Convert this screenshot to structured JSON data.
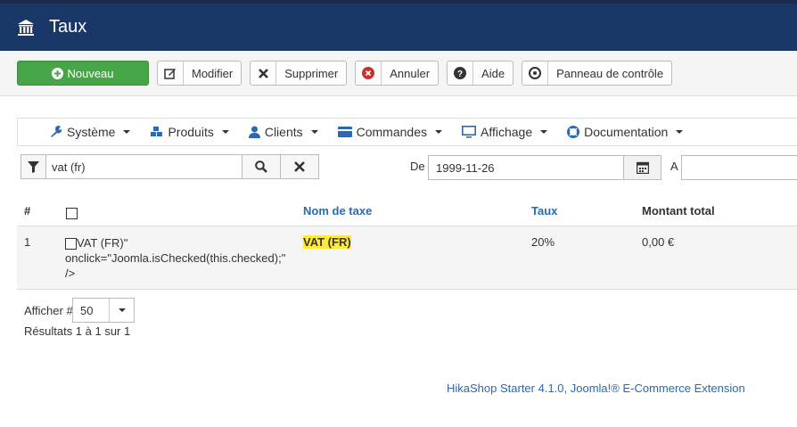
{
  "header": {
    "title": "Taux",
    "logo_icon": "bank-icon"
  },
  "toolbar": {
    "new_label": "Nouveau",
    "edit_label": "Modifier",
    "delete_label": "Supprimer",
    "cancel_label": "Annuler",
    "help_label": "Aide",
    "control_panel_label": "Panneau de contrôle"
  },
  "menu": {
    "items": [
      {
        "label": "Système",
        "icon": "wrench-icon"
      },
      {
        "label": "Produits",
        "icon": "cubes-icon"
      },
      {
        "label": "Clients",
        "icon": "user-icon"
      },
      {
        "label": "Commandes",
        "icon": "card-icon"
      },
      {
        "label": "Affichage",
        "icon": "monitor-icon"
      },
      {
        "label": "Documentation",
        "icon": "lifebuoy-icon"
      }
    ]
  },
  "filter": {
    "search_value": "vat (fr)",
    "from_label": "De",
    "from_value": "1999-11-26",
    "to_label": "A",
    "to_value": ""
  },
  "table": {
    "headers": {
      "num": "#",
      "name": "Nom de taxe",
      "rate": "Taux",
      "total": "Montant total"
    },
    "rows": [
      {
        "num": "1",
        "raw_text_1": "VAT (FR)\"",
        "raw_text_2": "onclick=\"Joomla.isChecked(this.checked);\"",
        "raw_text_3": "/>",
        "name": "VAT (FR)",
        "rate": "20%",
        "total": "0,00 €"
      }
    ]
  },
  "pagination": {
    "display_label": "Afficher #",
    "display_value": "50",
    "results_text": "Résultats 1 à 1 sur 1"
  },
  "footer": {
    "text": "HikaShop Starter 4.1.0, Joomla!® E-Commerce Extension"
  },
  "colors": {
    "header_bg": "#1a3867",
    "new_button": "#46a546",
    "link": "#2a69b8",
    "highlight": "#ffea3a"
  }
}
